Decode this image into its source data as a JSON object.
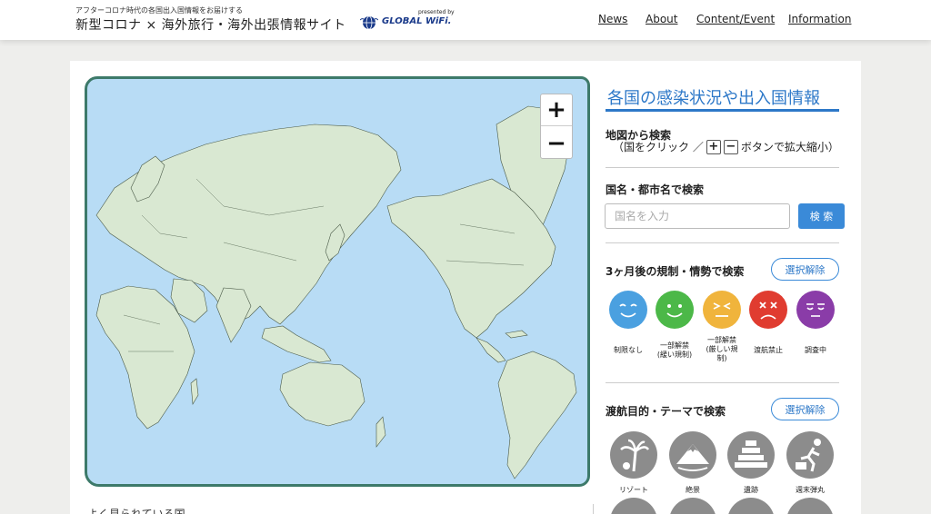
{
  "header": {
    "tagline": "アフターコロナ時代の各国出入国情報をお届けする",
    "site_title": "新型コロナ × 海外旅行・海外出張情報サイト",
    "presented_by": "presented by",
    "brand": "GLOBAL WiFi."
  },
  "nav": [
    {
      "label": "News"
    },
    {
      "label": "About"
    },
    {
      "label": "Content/Event"
    },
    {
      "label": "Information"
    }
  ],
  "map": {
    "zoom_in": "+",
    "zoom_out": "−",
    "land_color": "#d9e8d2",
    "water_color": "#b8dcf5",
    "frame_color": "#3d7a6a"
  },
  "below_map_text": "よく見られている国",
  "panel": {
    "title": "各国の感染状況や出入国情報",
    "map_search_title": "地図から検索",
    "map_search_sub_1": "（国をクリック ／",
    "map_search_sub_2": "ボタンで拡大縮小）",
    "kbd_plus": "+",
    "kbd_minus": "−",
    "name_search_title": "国名・都市名で検索",
    "search_placeholder": "国名を入力",
    "search_button": "検 索",
    "restriction_title": "3ヶ月後の規制・情勢で検索",
    "clear_button": "選択解除",
    "levels": [
      {
        "label": "制限なし",
        "color": "#4aa0e0"
      },
      {
        "label": "一部解禁\n(緩い規制)",
        "color": "#4cb848"
      },
      {
        "label": "一部解禁\n(厳しい規\n制)",
        "color": "#f0b43c"
      },
      {
        "label": "渡航禁止",
        "color": "#e03c30"
      },
      {
        "label": "調査中",
        "color": "#8a3ca8"
      }
    ],
    "theme_title": "渡航目的・テーマで検索",
    "themes": [
      {
        "label": "リゾート"
      },
      {
        "label": "絶景"
      },
      {
        "label": "遺跡"
      },
      {
        "label": "週末弾丸"
      }
    ]
  }
}
